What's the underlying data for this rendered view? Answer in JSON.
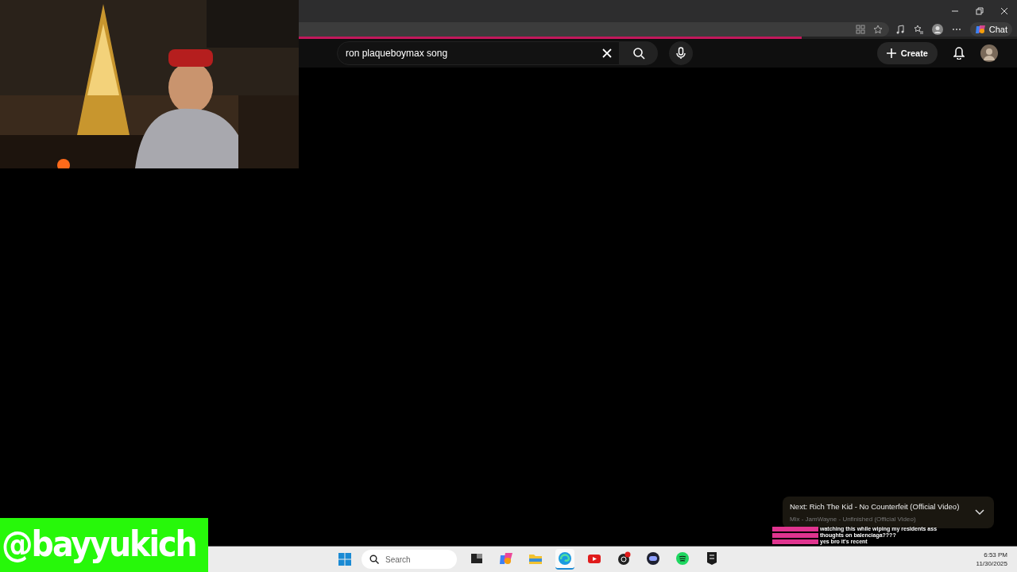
{
  "browser": {
    "copilot_label": "Chat"
  },
  "header": {
    "search": {
      "value": "ron plaqueboymax song"
    },
    "create_label": "Create"
  },
  "player": {
    "progress": {
      "level": 0.7
    },
    "next_up": {
      "title": "Next: Rich The Kid - No Counterfeit (Official Video)",
      "subtitle": "Mix - JamWayne - Unfinished (Official Video)",
      "expanded": false
    }
  },
  "overlay": {
    "name_tag": "@bayyukich",
    "chat": [
      {
        "message": "watching this while wiping my residents ass",
        "color": "#e0348f"
      },
      {
        "message": "thoughts on balenciaga????",
        "color": "#e0348f"
      },
      {
        "message": "yes bro it's recent",
        "color": "#e0348f"
      }
    ]
  },
  "taskbar": {
    "search_placeholder": "Search",
    "apps": [
      {
        "kind": "explorer-dark",
        "active": false
      },
      {
        "kind": "copilot",
        "active": false
      },
      {
        "kind": "folder",
        "active": false
      },
      {
        "kind": "edge",
        "active": true
      },
      {
        "kind": "youtube",
        "active": false
      },
      {
        "kind": "obs",
        "active": false
      },
      {
        "kind": "discord",
        "active": false
      },
      {
        "kind": "spotify",
        "active": false
      },
      {
        "kind": "epic",
        "active": false
      }
    ],
    "time": "6:53 PM",
    "date": "11/30/2025"
  }
}
